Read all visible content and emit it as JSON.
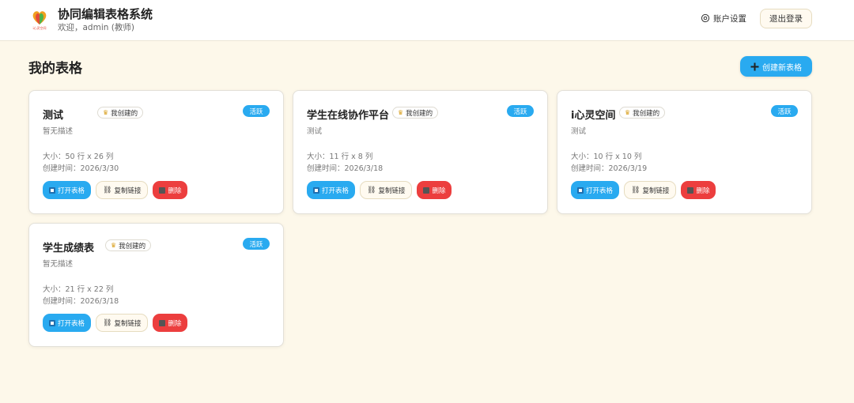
{
  "header": {
    "title": "协同编辑表格系统",
    "welcome": "欢迎，admin (教师)",
    "logo_caption": "i心灵空间",
    "account_label": "账户设置",
    "logout_label": "退出登录"
  },
  "page": {
    "heading": "我的表格",
    "create_label": "创建新表格"
  },
  "colors": {
    "accent": "#29aaf0",
    "danger": "#ec3e3e",
    "background": "#fdf8ea"
  },
  "cards": [
    {
      "title": "测试",
      "owner_tag": "我创建的",
      "status": "活跃",
      "description": "暂无描述",
      "size": "大小：50 行 x 26 列",
      "created": "创建时间：2026/3/30",
      "open_label": "打开表格",
      "copy_label": "复制链接",
      "delete_label": "删除"
    },
    {
      "title": "学生在线协作平台",
      "owner_tag": "我创建的",
      "status": "活跃",
      "description": "测试",
      "size": "大小：11 行 x 8 列",
      "created": "创建时间：2026/3/18",
      "open_label": "打开表格",
      "copy_label": "复制链接",
      "delete_label": "删除"
    },
    {
      "title": "i心灵空间",
      "owner_tag": "我创建的",
      "status": "活跃",
      "description": "测试",
      "size": "大小：10 行 x 10 列",
      "created": "创建时间：2026/3/19",
      "open_label": "打开表格",
      "copy_label": "复制链接",
      "delete_label": "删除"
    },
    {
      "title": "学生成绩表",
      "owner_tag": "我创建的",
      "status": "活跃",
      "description": "暂无描述",
      "size": "大小：21 行 x 22 列",
      "created": "创建时间：2026/3/18",
      "open_label": "打开表格",
      "copy_label": "复制链接",
      "delete_label": "删除"
    }
  ]
}
